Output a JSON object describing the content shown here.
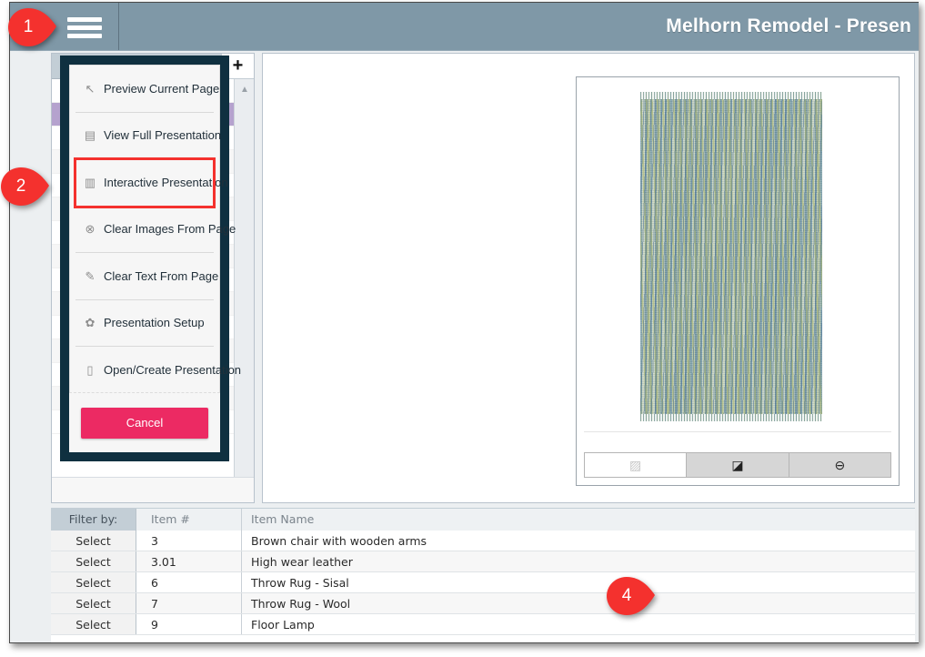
{
  "header": {
    "title": "Melhorn Remodel - Presen",
    "menu_icon": "hamburger-icon"
  },
  "pages_panel": {
    "header_label": "",
    "add_label": "+",
    "scroll_up": "▲",
    "scroll_down": "▼",
    "rows": [
      {
        "gear": "✿"
      },
      {
        "gear": "✿",
        "selected": true
      },
      {
        "gear": "✿"
      },
      {
        "gear": "✿"
      },
      {
        "gear": "✿"
      },
      {
        "gear": "✿"
      },
      {
        "gear": "✿"
      },
      {
        "gear": ""
      },
      {
        "gear": ""
      },
      {
        "gear": ""
      },
      {
        "gear": ""
      },
      {
        "gear": ""
      },
      {
        "gear": ""
      },
      {
        "gear": ""
      },
      {
        "gear": ""
      }
    ]
  },
  "image_panel": {
    "image_alt": "Throw rug - blue green woven texture",
    "toolbar": [
      {
        "icon": "image-icon",
        "glyph": "▨",
        "style": "light"
      },
      {
        "icon": "edit-icon",
        "glyph": "◪",
        "style": "dark"
      },
      {
        "icon": "remove-icon",
        "glyph": "⊖",
        "style": "dark"
      }
    ]
  },
  "menu": {
    "items": [
      {
        "icon": "cursor-arrow-icon",
        "glyph": "↖",
        "label": "Preview Current Page"
      },
      {
        "icon": "pdf-document-icon",
        "glyph": "▤",
        "label": "View Full Presentation"
      },
      {
        "icon": "presentation-chart-icon",
        "glyph": "▥",
        "label": "Interactive Presentation"
      },
      {
        "icon": "circle-x-icon",
        "glyph": "⊗",
        "label": "Clear Images From Page"
      },
      {
        "icon": "pencil-icon",
        "glyph": "✎",
        "label": "Clear Text From Page"
      },
      {
        "icon": "gear-icon",
        "glyph": "✿",
        "label": "Presentation Setup"
      },
      {
        "icon": "file-icon",
        "glyph": "▯",
        "label": "Open/Create Presentation"
      }
    ],
    "cancel_label": "Cancel"
  },
  "items_table": {
    "columns": [
      "Filter by:",
      "Item #",
      "Item Name"
    ],
    "select_label": "Select",
    "rows": [
      {
        "number": "3",
        "name": "Brown chair with wooden arms"
      },
      {
        "number": "3.01",
        "name": "High wear leather"
      },
      {
        "number": "6",
        "name": "Throw Rug - Sisal"
      },
      {
        "number": "7",
        "name": "Throw Rug - Wool"
      },
      {
        "number": "9",
        "name": "Floor Lamp"
      }
    ]
  },
  "callouts": [
    {
      "id": "1",
      "number": "1"
    },
    {
      "id": "2",
      "number": "2"
    },
    {
      "id": "4",
      "number": "4"
    }
  ],
  "colors": {
    "header_bg": "#7f98a7",
    "menu_border": "#0f3040",
    "highlight_outline": "#f4312e",
    "cancel_button": "#ec2a63",
    "selected_row": "#b5a2ce",
    "callout": "#f4312e"
  }
}
